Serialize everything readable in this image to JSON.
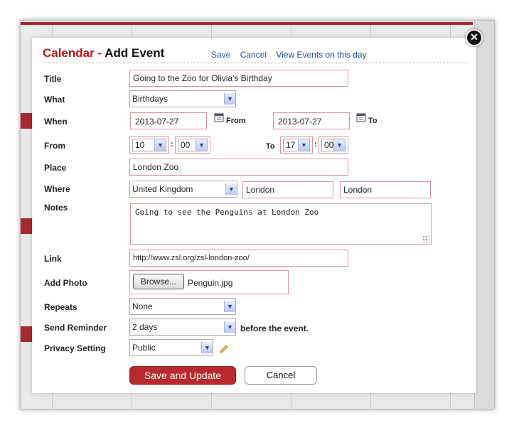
{
  "modal": {
    "title_calendar": "Calendar -",
    "title_add_event": "Add Event",
    "links": {
      "save": "Save",
      "cancel": "Cancel",
      "view_events": "View Events on this day"
    },
    "close_glyph": "✕"
  },
  "form": {
    "title": {
      "label": "Title",
      "value": "Going to the Zoo for Olivia's Birthday"
    },
    "what": {
      "label": "What",
      "value": "Birthdays"
    },
    "when": {
      "label": "When",
      "start_date": "2013-07-27",
      "from_label": "From",
      "end_date": "2013-07-27",
      "to_label": "To"
    },
    "from": {
      "label": "From",
      "start_hour": "10",
      "start_min": "00",
      "to_label": "To",
      "end_hour": "17",
      "end_min": "00",
      "sep": ":"
    },
    "place": {
      "label": "Place",
      "value": "London Zoo"
    },
    "where": {
      "label": "Where",
      "country": "United Kingdom",
      "city": "London",
      "region": "London"
    },
    "notes": {
      "label": "Notes",
      "value": "Going to see the Penguins at London Zoo"
    },
    "link": {
      "label": "Link",
      "value": "http://www.zsl.org/zsl-london-zoo/"
    },
    "photo": {
      "label": "Add Photo",
      "browse": "Browse...",
      "filename": "Penguin.jpg"
    },
    "repeats": {
      "label": "Repeats",
      "value": "None"
    },
    "reminder": {
      "label": "Send Reminder",
      "value": "2 days",
      "suffix": "before the event."
    },
    "privacy": {
      "label": "Privacy Setting",
      "value": "Public"
    }
  },
  "buttons": {
    "save_update": "Save and Update",
    "cancel": "Cancel"
  },
  "colors": {
    "accent": "#c0141a",
    "button": "#b82a2d",
    "link": "#1a4d8f"
  },
  "icons": {
    "calendar": "calendar-icon",
    "pencil": "pencil-icon",
    "close": "close-icon",
    "dropdown": "chevron-down-icon"
  }
}
